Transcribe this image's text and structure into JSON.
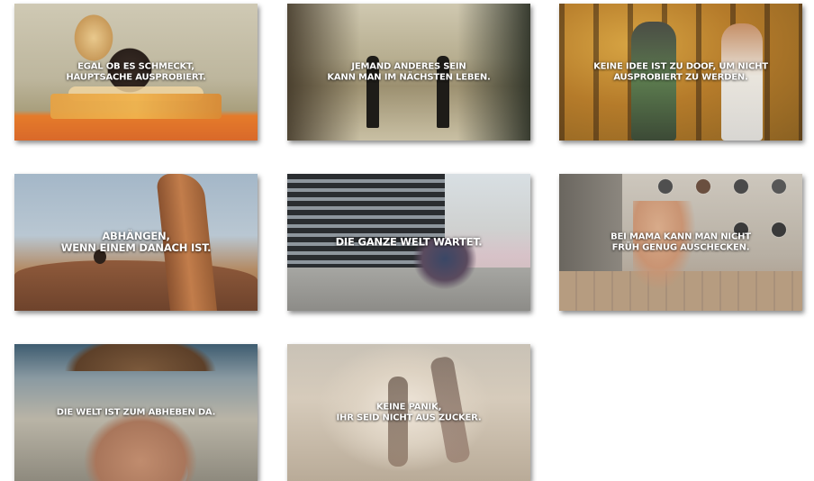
{
  "tiles": [
    {
      "caption": "EGAL OB ES SCHMECKT,\nHAUPTSACHE AUSPROBIERT."
    },
    {
      "caption": "JEMAND ANDERES SEIN\nKANN MAN IM NÄCHSTEN LEBEN."
    },
    {
      "caption": "KEINE IDEE IST ZU DOOF, UM NICHT\nAUSPROBIERT ZU WERDEN."
    },
    {
      "caption": "ABHÄNGEN,\nWENN EINEM DANACH IST."
    },
    {
      "caption": "DIE GANZE WELT WARTET."
    },
    {
      "caption": "BEI MAMA KANN MAN NICHT\nFRÜH GENUG AUSCHECKEN."
    },
    {
      "caption": "DIE WELT IST ZUM ABHEBEN DA."
    },
    {
      "caption": "KEINE PANIK,\nIHR SEID NICHT AUS ZUCKER."
    }
  ],
  "colors": {
    "background": "#ffffff",
    "caption": "#ffffff"
  }
}
